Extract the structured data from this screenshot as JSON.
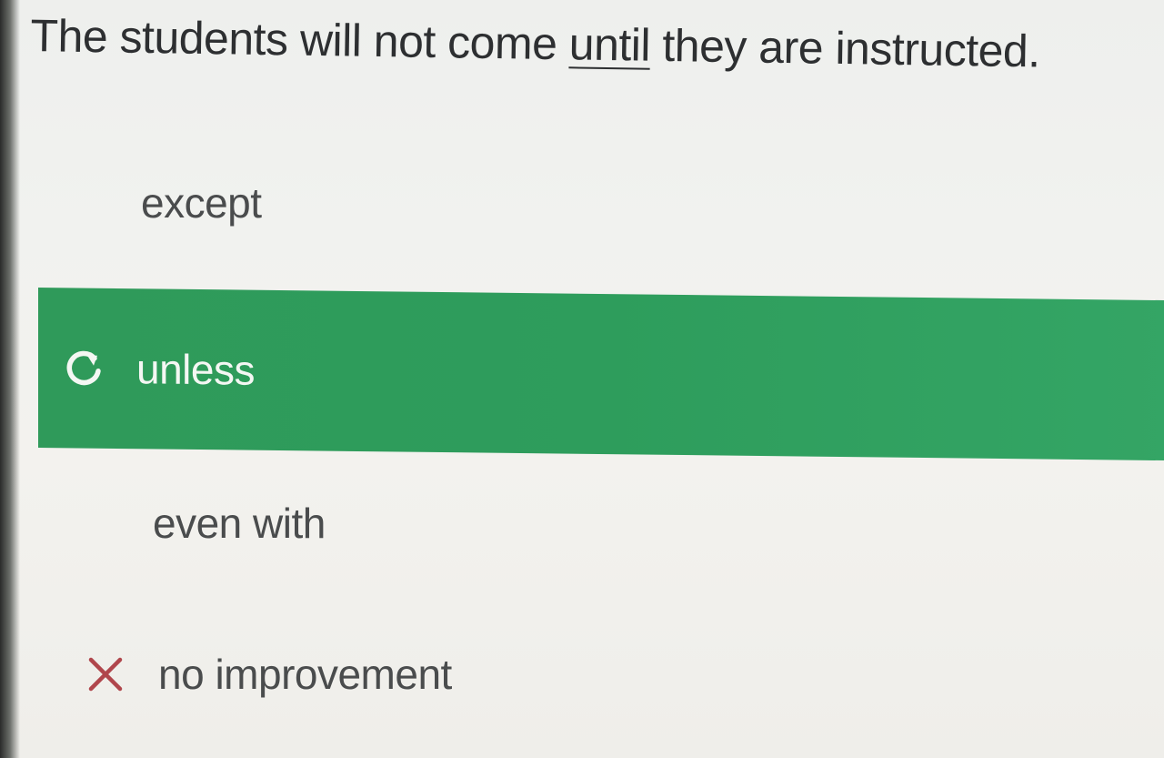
{
  "question": {
    "before": "The students will not come ",
    "keyword": "until",
    "after": " they are instructed."
  },
  "options": [
    {
      "label": "except",
      "state": "default"
    },
    {
      "label": "unless",
      "state": "selected-correct",
      "icon": "refresh-icon"
    },
    {
      "label": "even with",
      "state": "default"
    },
    {
      "label": "no improvement",
      "state": "incorrect",
      "icon": "close-x-icon"
    }
  ],
  "colors": {
    "correct_green": "#2f9a5a",
    "incorrect_red": "#b0464c",
    "text": "#2d2f31",
    "background": "#f1f2ef"
  }
}
